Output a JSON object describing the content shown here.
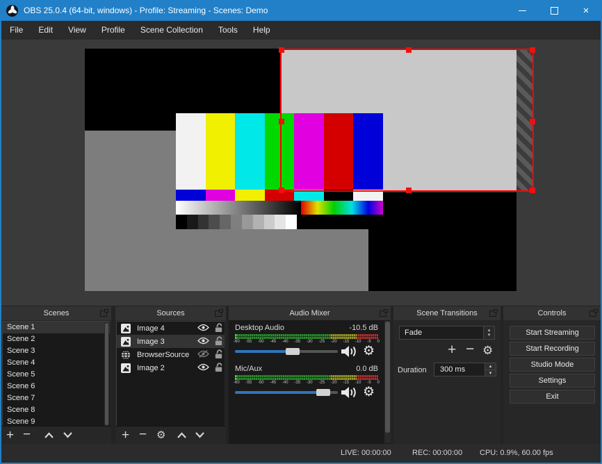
{
  "window": {
    "title": "OBS 25.0.4 (64-bit, windows) - Profile: Streaming - Scenes: Demo",
    "accent_color": "#2180c8",
    "buttons": [
      "minimize",
      "maximize",
      "close"
    ]
  },
  "menu": {
    "items": [
      "File",
      "Edit",
      "View",
      "Profile",
      "Scene Collection",
      "Tools",
      "Help"
    ]
  },
  "preview": {
    "selection_color": "#ff0000",
    "canvas_gray": "#7d7d7d",
    "selected_source_gray": "#c8c8c8",
    "color_bars": {
      "main": [
        "#f2f2f2",
        "#f0f000",
        "#00e8e8",
        "#00d800",
        "#e000e0",
        "#d40000",
        "#0000d8"
      ],
      "castellation": [
        "#0000d8",
        "#e000e0",
        "#f0f000",
        "#d40000",
        "#00e8e8",
        "#000000",
        "#f2f2f2"
      ],
      "gray_steps": [
        "#000000",
        "#191919",
        "#333333",
        "#4c4c4c",
        "#666666",
        "#7f7f7f",
        "#999999",
        "#b2b2b2",
        "#cccccc",
        "#e5e5e5",
        "#ffffff"
      ]
    }
  },
  "panels": {
    "scenes": {
      "title": "Scenes"
    },
    "sources": {
      "title": "Sources"
    },
    "audio_mixer": {
      "title": "Audio Mixer"
    },
    "scene_transitions": {
      "title": "Scene Transitions"
    },
    "controls": {
      "title": "Controls"
    }
  },
  "scenes": {
    "items": [
      "Scene 1",
      "Scene 2",
      "Scene 3",
      "Scene 4",
      "Scene 5",
      "Scene 6",
      "Scene 7",
      "Scene 8",
      "Scene 9"
    ],
    "selected": "Scene 1"
  },
  "sources": {
    "items": [
      {
        "name": "Image 4",
        "icon": "image",
        "visible": true,
        "locked": false
      },
      {
        "name": "Image 3",
        "icon": "image",
        "visible": true,
        "locked": false,
        "selected": true
      },
      {
        "name": "BrowserSource",
        "icon": "globe",
        "visible": false,
        "locked": false
      },
      {
        "name": "Image 2",
        "icon": "image",
        "visible": true,
        "locked": false
      }
    ]
  },
  "audio_mixer": {
    "ticks": [
      "-60",
      "-55",
      "-50",
      "-45",
      "-40",
      "-35",
      "-30",
      "-25",
      "-20",
      "-15",
      "-10",
      "-5",
      "0"
    ],
    "meter_colors": {
      "green": "#2e8b2e",
      "yellow": "#98982a",
      "red": "#a83232"
    },
    "slider_color": "#2d76bc",
    "channels": [
      {
        "name": "Desktop Audio",
        "level": "-10.5 dB",
        "slider_pct": 56
      },
      {
        "name": "Mic/Aux",
        "level": "0.0 dB",
        "slider_pct": 86
      }
    ]
  },
  "scene_transitions": {
    "selected_transition": "Fade",
    "duration_label": "Duration",
    "duration_value": "300 ms"
  },
  "controls": {
    "buttons": [
      "Start Streaming",
      "Start Recording",
      "Studio Mode",
      "Settings",
      "Exit"
    ]
  },
  "status_bar": {
    "live": "LIVE: 00:00:00",
    "rec": "REC: 00:00:00",
    "cpu": "CPU: 0.9%, 60.00 fps"
  }
}
